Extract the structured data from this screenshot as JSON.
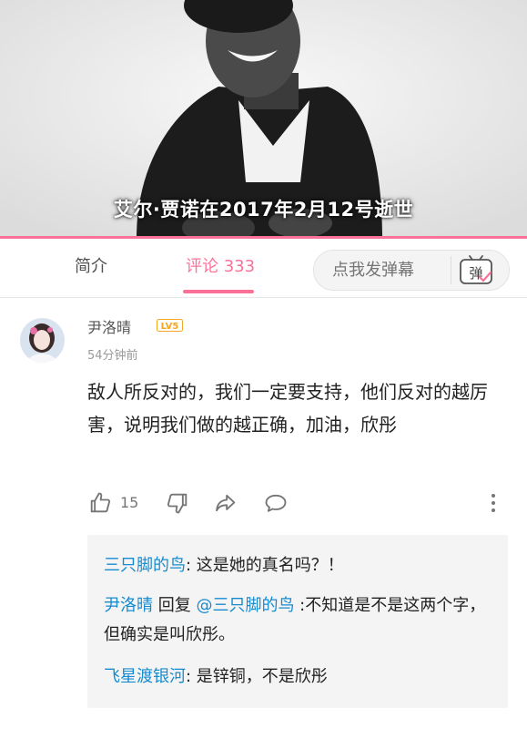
{
  "video": {
    "subtitle": "艾尔·贾诺在2017年2月12号逝世",
    "progress_accent": "#fb7299"
  },
  "tabs": {
    "intro_label": "简介",
    "comments_label": "评论",
    "comments_count": "333",
    "danmaku_placeholder": "点我发弹幕",
    "danmaku_icon_char": "弹"
  },
  "comment": {
    "username": "尹洛晴",
    "level": "LV5",
    "time": "54分钟前",
    "content": "敌人所反对的，我们一定要支持，他们反对的越厉害，说明我们做的越正确，加油，欣彤",
    "likes": "15"
  },
  "replies": [
    {
      "author": "三只脚的鸟",
      "sep": ": ",
      "text": "这是她的真名吗？！"
    },
    {
      "author": "尹洛晴",
      "reply_word": " 回复 ",
      "mention": "@三只脚的鸟",
      "text": " :不知道是不是这两个字，但确实是叫欣彤。"
    },
    {
      "author": "飞星渡银河",
      "sep": ": ",
      "text": "是锌铜，不是欣彤"
    }
  ],
  "colors": {
    "accent": "#fb7299",
    "link": "#178bcf",
    "level_badge": "#f5a623"
  }
}
